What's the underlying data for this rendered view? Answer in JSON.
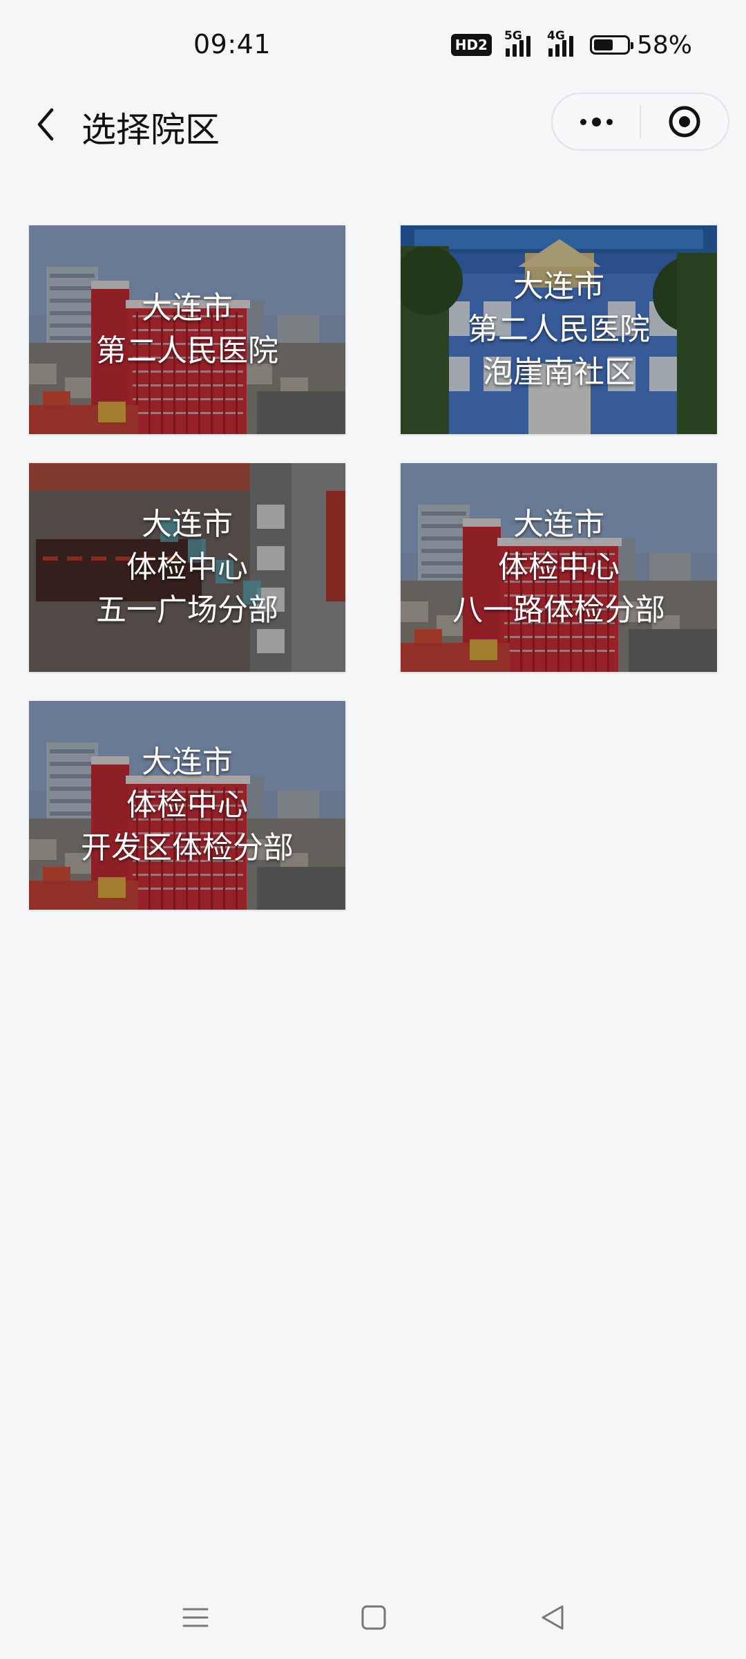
{
  "status_bar": {
    "time": "09:41",
    "hd_label": "HD2",
    "signal_1_label": "5G",
    "signal_2_label": "4G",
    "battery_text": "58%",
    "battery_level": 0.58
  },
  "nav": {
    "title": "选择院区",
    "back_icon": "chevron-left-icon",
    "more_icon": "more-dots-icon",
    "close_icon": "target-circle-icon"
  },
  "campuses": [
    {
      "lines": [
        "大连市",
        "第二人民医院"
      ],
      "image": "city-red-building"
    },
    {
      "lines": [
        "大连市",
        "第二人民医院",
        "泡崖南社区"
      ],
      "image": "blue-clinic-building"
    },
    {
      "lines": [
        "大连市",
        "体检中心",
        "五一广场分部"
      ],
      "image": "gray-building-sign"
    },
    {
      "lines": [
        "大连市",
        "体检中心",
        "八一路体检分部"
      ],
      "image": "city-red-building"
    },
    {
      "lines": [
        "大连市",
        "体检中心",
        "开发区体检分部"
      ],
      "image": "city-red-building"
    }
  ],
  "system_nav": {
    "menu_icon": "menu-icon",
    "home_icon": "home-square-icon",
    "back_icon": "back-triangle-icon"
  },
  "colors": {
    "background": "#f5f6f8",
    "text": "#111111",
    "card_text": "#ffffff"
  }
}
